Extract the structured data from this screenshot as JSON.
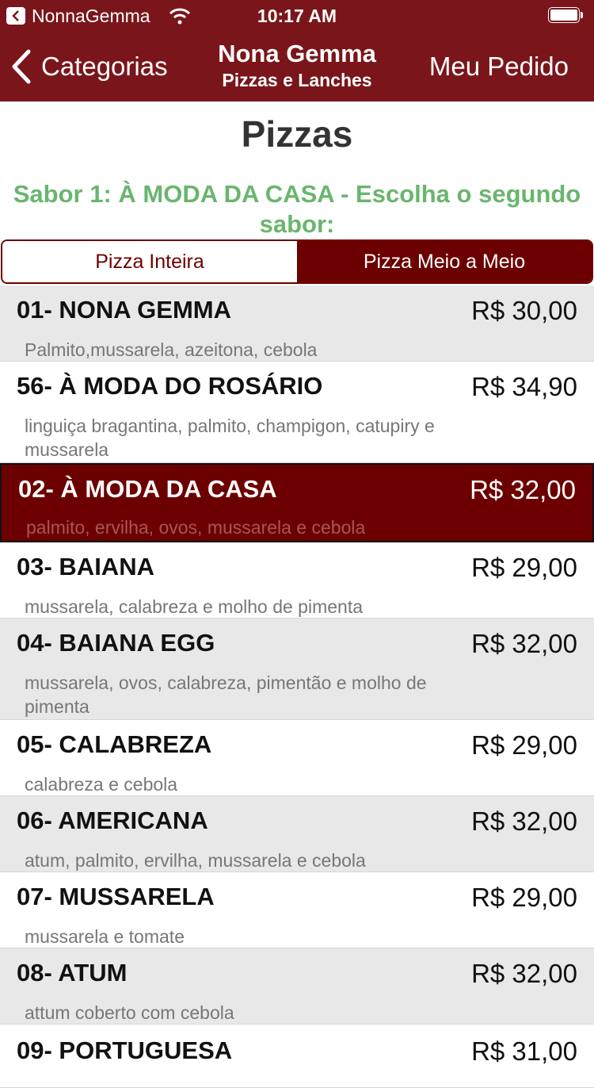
{
  "status_bar": {
    "app_name": "NonnaGemma",
    "time": "10:17 AM"
  },
  "nav": {
    "back_label": "Categorias",
    "title": "Nona Gemma",
    "subtitle": "Pizzas e Lanches",
    "right_label": "Meu Pedido"
  },
  "page_title": "Pizzas",
  "flavor_message": "Sabor 1: À MODA DA CASA  - Escolha o segundo sabor:",
  "segment": {
    "options": [
      "Pizza Inteira",
      "Pizza Meio a Meio"
    ],
    "selected": "Pizza Meio a Meio"
  },
  "colors": {
    "brand": "#7a161b",
    "selected_row": "#6c0000",
    "message_green": "#6ab56e"
  },
  "items": [
    {
      "name": "01- NONA GEMMA",
      "price": "R$ 30,00",
      "description": "Palmito,mussarela, azeitona, cebola",
      "selected": false
    },
    {
      "name": "56- À MODA DO ROSÁRIO",
      "price": "R$ 34,90",
      "description": "linguiça bragantina, palmito, champigon, catupiry e mussarela",
      "selected": false
    },
    {
      "name": "02- À MODA DA CASA",
      "price": "R$ 32,00",
      "description": "palmito, ervilha, ovos, mussarela e cebola",
      "selected": true
    },
    {
      "name": "03- BAIANA",
      "price": "R$ 29,00",
      "description": "mussarela, calabreza e molho de pimenta",
      "selected": false
    },
    {
      "name": "04- BAIANA EGG",
      "price": "R$ 32,00",
      "description": "mussarela, ovos, calabreza, pimentão e molho de pimenta",
      "selected": false
    },
    {
      "name": "05- CALABREZA",
      "price": "R$ 29,00",
      "description": "calabreza e cebola",
      "selected": false
    },
    {
      "name": "06- AMERICANA",
      "price": "R$ 32,00",
      "description": "atum, palmito, ervilha, mussarela e cebola",
      "selected": false
    },
    {
      "name": "07- MUSSARELA",
      "price": "R$ 29,00",
      "description": "mussarela e tomate",
      "selected": false
    },
    {
      "name": "08- ATUM",
      "price": "R$ 32,00",
      "description": "attum coberto com cebola",
      "selected": false
    },
    {
      "name": "09- PORTUGUESA",
      "price": "R$ 31,00",
      "description": "",
      "selected": false
    }
  ]
}
